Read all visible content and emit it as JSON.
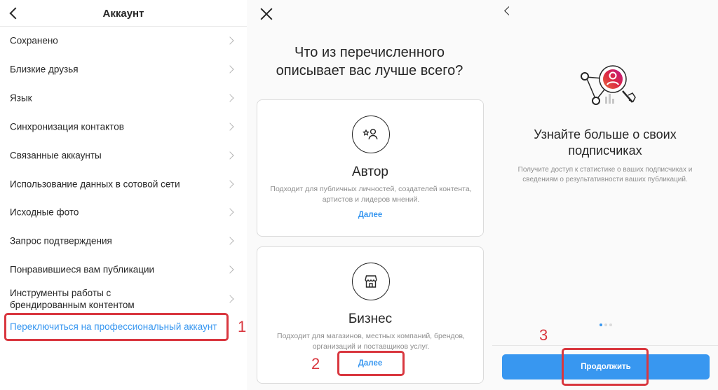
{
  "account_screen": {
    "title": "Аккаунт",
    "items": [
      {
        "label": "Сохранено"
      },
      {
        "label": "Близкие друзья"
      },
      {
        "label": "Язык"
      },
      {
        "label": "Синхронизация контактов"
      },
      {
        "label": "Связанные аккаунты"
      },
      {
        "label": "Использование данных в сотовой сети"
      },
      {
        "label": "Исходные фото"
      },
      {
        "label": "Запрос подтверждения"
      },
      {
        "label": "Понравившиеся вам публикации"
      },
      {
        "label": "Инструменты работы с брендированным контентом"
      }
    ],
    "switch_link": "Переключиться на профессиональный аккаунт",
    "step": "1"
  },
  "choice_screen": {
    "question": "Что из перечисленного описывает вас лучше всего?",
    "cards": [
      {
        "title": "Автор",
        "description": "Подходит для публичных личностей, создателей контента, артистов и лидеров мнений.",
        "link": "Далее",
        "icon": "creator-star-person-icon"
      },
      {
        "title": "Бизнес",
        "description": "Подходит для магазинов, местных компаний, брендов, организаций и поставщиков услуг.",
        "link": "Далее",
        "icon": "storefront-icon"
      }
    ],
    "step": "2"
  },
  "insights_screen": {
    "title": "Узнайте больше о своих подписчиках",
    "description": "Получите доступ к статистике о ваших подписчиках и сведениям о результативности ваших публикаций.",
    "button_label": "Продолжить",
    "step": "3",
    "page_dots": {
      "count": 3,
      "active_index": 0
    }
  },
  "colors": {
    "accent_blue": "#3897f0",
    "annotation_red": "#d9373f",
    "gradient_start": "#e6683c",
    "gradient_mid": "#dc2743",
    "gradient_end": "#bc1888"
  }
}
